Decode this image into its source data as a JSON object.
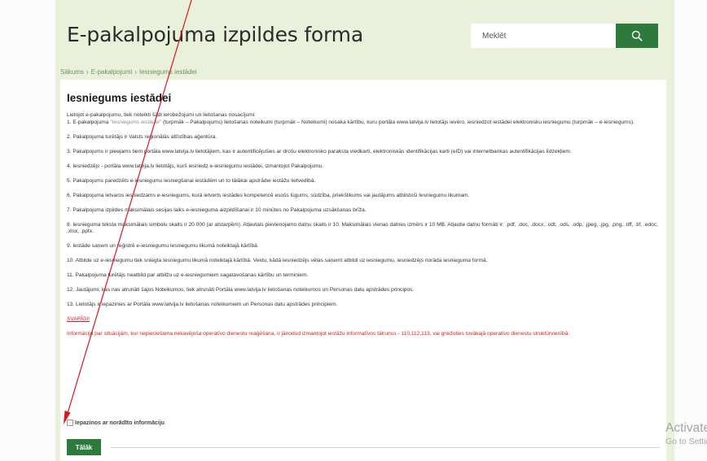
{
  "header": {
    "title": "E-pakalpojuma izpildes forma",
    "search_placeholder": "Meklēt"
  },
  "breadcrumb": [
    "Sākums",
    "E-pakalpojumi",
    "Iesniegums iestādei"
  ],
  "form": {
    "heading": "Iesniegums iestādei",
    "intro": "Lietojot e-pakalpojumu, tiek noteikti šādi ierobežojumi un lietošanas nosacījumi:",
    "term1_a": "1. E-pakalpojuma ",
    "term1_em": "\"Iesniegums iestādei\"",
    "term1_b": " (turpmāk – Pakalpojums) lietošanas noteikumi (turpmāk – Noteikumi) nosaka kārtību, kuru portāla www.latvija.lv lietotājs ievēro, iesniedzot iestādei elektronisku iesniegumu (turpmāk – e-iesniegums).",
    "term2": "2. Pakalpojuma turētājs ir Valsts reģionālās attīstības aģentūra.",
    "term3": "3. Pakalpojums ir pieejams tiem portāla www.latvija.lv lietotājiem, kas ir autentificējušies ar drošu elektronisko paraksta viedkarti, elektroniskās identifikācijas karti (eID) vai internetbankas autentifikācijas līdzekļiem.",
    "term4": "4. Iesniedzējs - portāla www.latvija.lv lietotājs, kurš iesniedz e-iesniegumu iestādei, izmantojot Pakalpojumu.",
    "term5": "5. Pakalpojums paredzēts e-iesniegumu iesniegšanai iestādēm un to tālākai apstrādei iestāžu lietvedībā.",
    "term6": "6. Pakalpojuma ietvaros iesniedzams e-iesniegums, kurā ietverts iestādes kompetencē esošs lūgums, sūdzība, priekšlikums vai jautājums atbilstoši Iesniegumu likumam.",
    "term7": "7. Pakalpojuma izpildes maksimālais sesijas laiks e-iesnieguma aizpildīšanai ir 10 minūtes no Pakalpojuma uzsākšanas brīža.",
    "term8": "8. Iesnieguma teksta maksimālais simbolu skaits ir 20 000 (ar atstarpēm). Atļautais pievienojamo datņu skaits ir 10. Maksimālais vienas datnes izmērs ir 10 MB. Atļautie datņu formāti ir: .pdf, .doc, .docx, .odt, .ods, .odp, .jpeg, .jpg, .png, .tiff, .tif, .edoc, .xlsx, .pptx.",
    "term9": "9. Iestāde saņem un reģistrē e-iesniegumu Iesniegumu likumā noteiktajā kārtībā.",
    "term10": "10. Atbilde uz e-iesniegumu tiek sniegta Iesniegumu likumā noteiktajā kārtībā. Veidu, kādā iesniedzējs vēlas saņemt atbildi uz iesniegumu, iesniedzējs norāda iesnieguma formā.",
    "term11": "11. Pakalpojuma turētājs neatbild par atbilžu uz e-iesniegumiem sagatavošanas kārtību un termiņiem.",
    "term12": "12. Jautājumi, kas nav atrunāti šajos Noteikumos, tiek atrunāti Portāla www.latvija.lv lietošanas noteikumos un Personas datu apstrādes principos.",
    "term13": "13. Lietotājs ir iepazinies ar Portāla www.latvija.lv lietošanas noteikumiem un Personas datu apstrādes principiem.",
    "important_label": "SVARĪGI!",
    "important_text": "Informāciju par situācijām, kur nepieciešama nekavējoša operatīvo dienestu reaģēšana, ir jānodod izmantojot iestāžu informatīvos tālruņus - 110,112,113, vai griežoties tuvākajā operatīvo dienestu struktūrvienībā.",
    "agree_label": "Iepazinos ar norādīto informāciju",
    "agree_checked": false,
    "next_button": "Tālāk"
  },
  "watermark": {
    "title": "Activate Windows",
    "subtitle": "Go to Settings to activate Windows."
  },
  "colors": {
    "brand_green": "#2e7a3c",
    "page_background": "#e9f1da",
    "warning_red": "#d41d1d",
    "annotation_red": "#e0141e"
  },
  "icons": {
    "search": "search-icon"
  }
}
